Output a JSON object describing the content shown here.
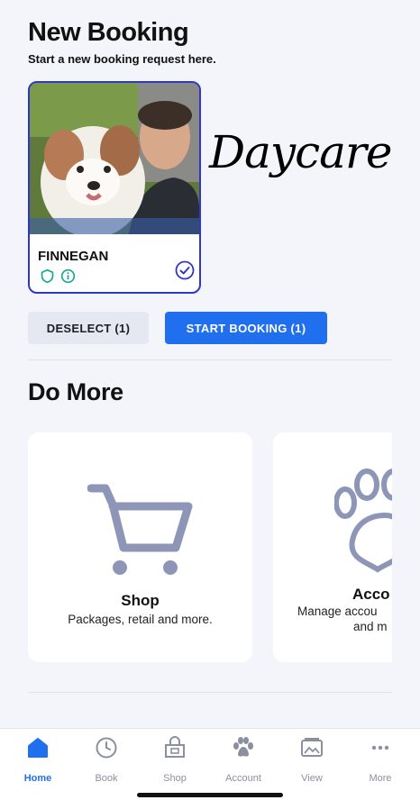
{
  "header": {
    "title": "New Booking",
    "subtitle": "Start a new booking request here."
  },
  "pet": {
    "name": "FINNEGAN",
    "selected": true
  },
  "overlay_label": "Daycare",
  "actions": {
    "deselect_label": "DESELECT (1)",
    "start_label": "START BOOKING (1)"
  },
  "do_more": {
    "title": "Do More",
    "tiles": [
      {
        "title": "Shop",
        "description": "Packages, retail and more."
      },
      {
        "title": "Acco",
        "description_line1": "Manage accou",
        "description_line2": "and m"
      }
    ]
  },
  "tabs": [
    {
      "label": "Home",
      "icon": "home-icon",
      "active": true
    },
    {
      "label": "Book",
      "icon": "clock-icon",
      "active": false
    },
    {
      "label": "Shop",
      "icon": "shop-bag-icon",
      "active": false
    },
    {
      "label": "Account",
      "icon": "paw-icon",
      "active": false
    },
    {
      "label": "View",
      "icon": "gallery-icon",
      "active": false
    },
    {
      "label": "More",
      "icon": "ellipsis-icon",
      "active": false
    }
  ],
  "colors": {
    "accent": "#1f6fef",
    "card_border": "#2f37c9",
    "icon_gray": "#8e96b8",
    "badge_teal": "#1aa88f"
  }
}
